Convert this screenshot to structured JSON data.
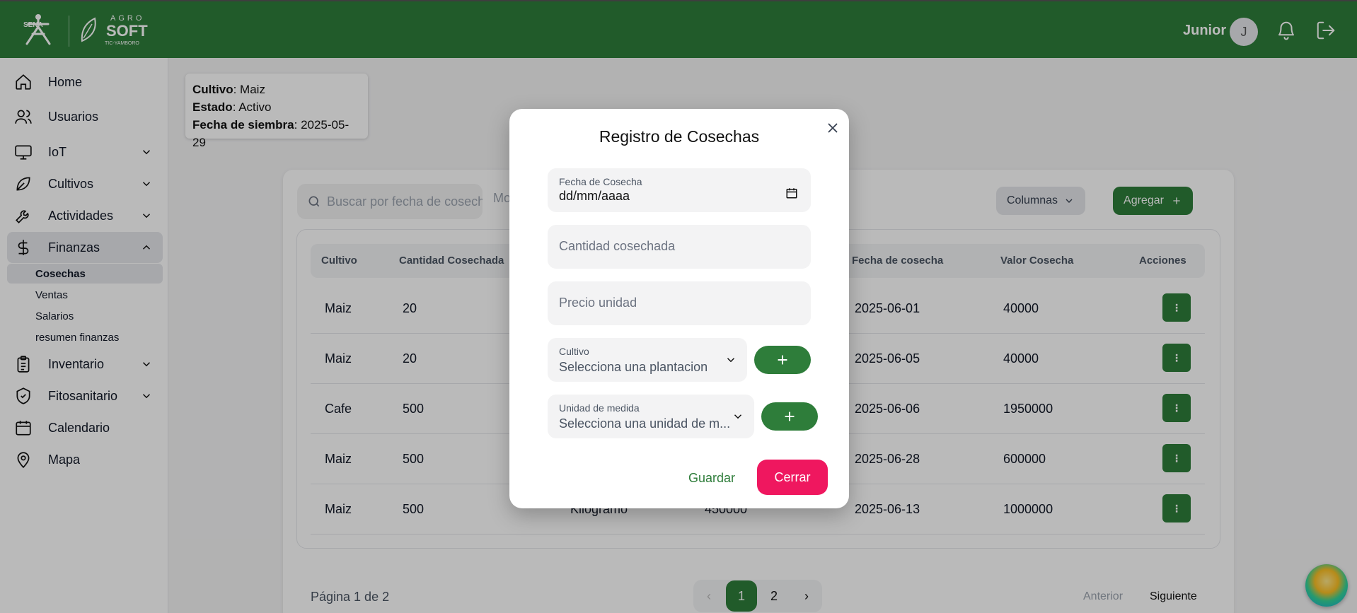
{
  "header": {
    "logo_sena": "SENA",
    "logo_agro_top": "AGRO",
    "logo_agro_main": "SOFT",
    "logo_agro_sub": "TIC-YAMBORO",
    "user_name": "Junior",
    "avatar_initial": "J",
    "colors": {
      "brand": "#2e7d3a"
    }
  },
  "sidebar": {
    "items": [
      {
        "label": "Home",
        "icon": "home-icon"
      },
      {
        "label": "Usuarios",
        "icon": "users-icon"
      },
      {
        "label": "IoT",
        "icon": "monitor-icon"
      },
      {
        "label": "Cultivos",
        "icon": "leaf-icon"
      },
      {
        "label": "Actividades",
        "icon": "wrench-icon"
      },
      {
        "label": "Finanzas",
        "icon": "dollar-icon"
      },
      {
        "label": "Inventario",
        "icon": "clipboard-icon"
      },
      {
        "label": "Fitosanitario",
        "icon": "shield-icon"
      },
      {
        "label": "Calendario",
        "icon": "calendar-icon"
      },
      {
        "label": "Mapa",
        "icon": "map-pin-icon"
      }
    ],
    "finanzas_sub": [
      "Cosechas",
      "Ventas",
      "Salarios",
      "resumen finanzas"
    ]
  },
  "info_card": {
    "cultivo_label": "Cultivo",
    "cultivo_value": ": Maiz",
    "estado_label": "Estado",
    "estado_value": ": Activo",
    "fecha_label": "Fecha de siembra",
    "fecha_value": ": 2025-05-29"
  },
  "toolbar": {
    "search_placeholder": "Buscar por fecha de cosecha",
    "partial_text": "Mo",
    "columns_label": "Columnas",
    "add_label": "Agregar"
  },
  "table": {
    "headers": [
      "Cultivo",
      "Cantidad Cosechada",
      "Fecha de cosecha",
      "Valor Cosecha",
      "Acciones"
    ],
    "rows": [
      {
        "cultivo": "Maiz",
        "cantidad": "20",
        "unidad": "",
        "precio": "",
        "fecha": "2025-06-01",
        "valor": "40000"
      },
      {
        "cultivo": "Maiz",
        "cantidad": "20",
        "unidad": "",
        "precio": "",
        "fecha": "2025-06-05",
        "valor": "40000"
      },
      {
        "cultivo": "Cafe",
        "cantidad": "500",
        "unidad": "",
        "precio": "",
        "fecha": "2025-06-06",
        "valor": "1950000"
      },
      {
        "cultivo": "Maiz",
        "cantidad": "500",
        "unidad": "",
        "precio": "",
        "fecha": "2025-06-28",
        "valor": "600000"
      },
      {
        "cultivo": "Maiz",
        "cantidad": "500",
        "unidad": "Kilogramo",
        "precio": "450000",
        "fecha": "2025-06-13",
        "valor": "1000000"
      }
    ],
    "action_glyph": "⋮"
  },
  "pagination": {
    "info": "Página 1 de 2",
    "pages": [
      "1",
      "2"
    ],
    "prev": "Anterior",
    "next": "Siguiente"
  },
  "modal": {
    "title": "Registro de Cosechas",
    "fecha_label": "Fecha de Cosecha",
    "fecha_value": "dd/mm/aaaa",
    "cantidad_placeholder": "Cantidad cosechada",
    "precio_placeholder": "Precio unidad",
    "cultivo_label": "Cultivo",
    "cultivo_value": "Selecciona una plantacion",
    "unidad_label": "Unidad de medida",
    "unidad_value": "Selecciona una unidad de m...",
    "save_label": "Guardar",
    "close_label": "Cerrar",
    "colors": {
      "close_button": "#ef175f",
      "save_text": "#2e7d3a"
    }
  }
}
